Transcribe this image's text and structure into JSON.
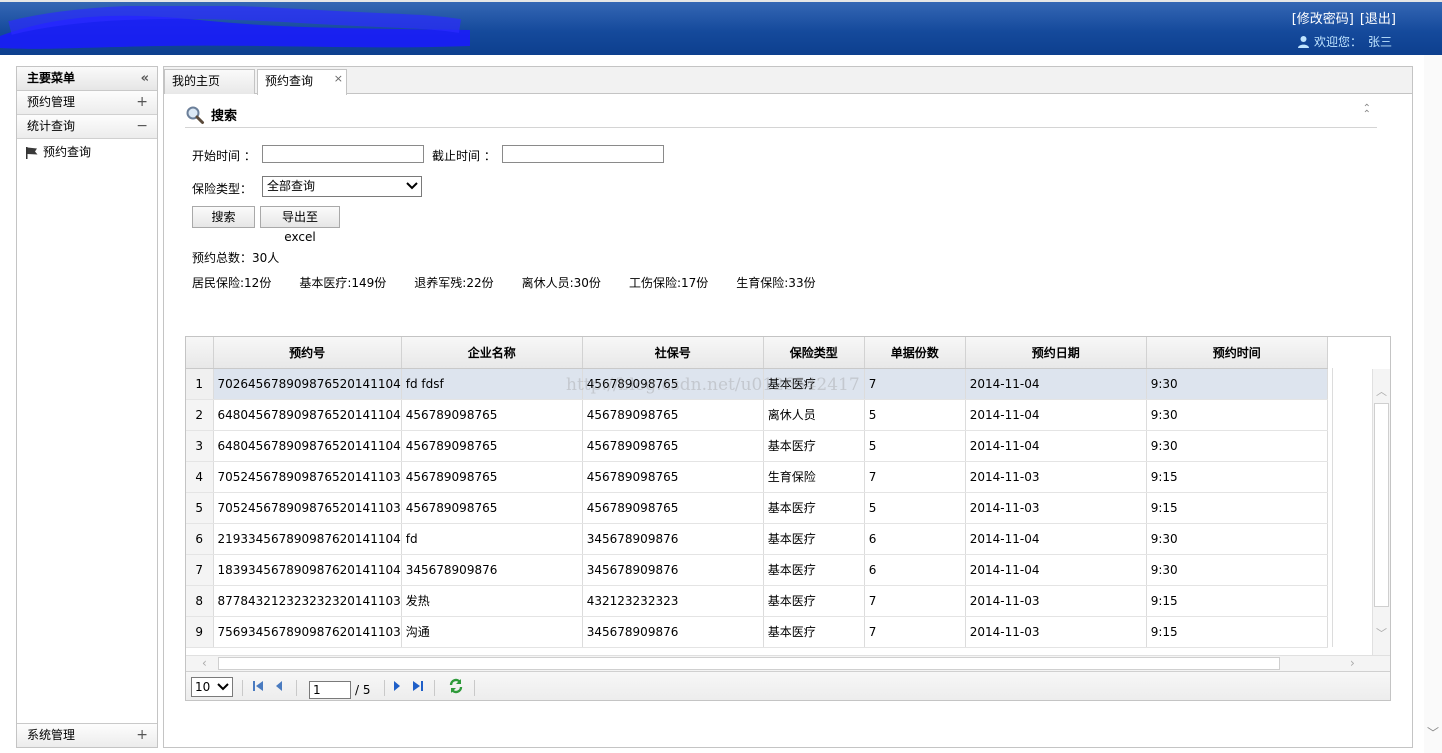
{
  "header": {
    "change_password": "[修改密码]",
    "logout": "[退出]",
    "welcome_label": "欢迎您：",
    "user_name": "张三"
  },
  "sidebar": {
    "title": "主要菜单",
    "collapse_glyph": "«",
    "groups": [
      {
        "label": "预约管理",
        "toggle": "+"
      },
      {
        "label": "统计查询",
        "toggle": "−"
      }
    ],
    "items": [
      {
        "label": "预约查询"
      }
    ],
    "bottom_group": {
      "label": "系统管理",
      "toggle": "+"
    }
  },
  "tabs": [
    {
      "label": "我的主页"
    },
    {
      "label": "预约查询",
      "close": "×"
    }
  ],
  "search": {
    "title": "搜索",
    "start_label": "开始时间 ：",
    "start_value": "",
    "end_label": "截止时间 ：",
    "end_value": "",
    "type_label": "保险类型：",
    "type_value": "全部查询",
    "search_button": "搜索",
    "export_button": "导出至excel"
  },
  "summary": {
    "total": "预约总数：30人",
    "items": [
      "居民保险:12份",
      "基本医疗:149份",
      "退养军残:22份",
      "离休人员:30份",
      "工伤保险:17份",
      "生育保险:33份"
    ]
  },
  "grid": {
    "columns": [
      "预约号",
      "企业名称",
      "社保号",
      "保险类型",
      "单据份数",
      "预约日期",
      "预约时间"
    ],
    "rows": [
      {
        "n": "1",
        "cells": [
          "70264567890987652014110​4",
          "fd fdsf",
          "456789098765",
          "基本医疗",
          "7",
          "2014-11-04",
          "9:30"
        ]
      },
      {
        "n": "2",
        "cells": [
          "64804567890987652014110​4",
          "456789098765",
          "456789098765",
          "离休人员",
          "5",
          "2014-11-04",
          "9:30"
        ]
      },
      {
        "n": "3",
        "cells": [
          "64804567890987652014110​4",
          "456789098765",
          "456789098765",
          "基本医疗",
          "5",
          "2014-11-04",
          "9:30"
        ]
      },
      {
        "n": "4",
        "cells": [
          "70524567890987652014110​3",
          "456789098765",
          "456789098765",
          "生育保险",
          "7",
          "2014-11-03",
          "9:15"
        ]
      },
      {
        "n": "5",
        "cells": [
          "70524567890987652014110​3",
          "456789098765",
          "456789098765",
          "基本医疗",
          "5",
          "2014-11-03",
          "9:15"
        ]
      },
      {
        "n": "6",
        "cells": [
          "21933456789098762014110​4",
          "fd",
          "345678909876",
          "基本医疗",
          "6",
          "2014-11-04",
          "9:30"
        ]
      },
      {
        "n": "7",
        "cells": [
          "18393456789098762014110​4",
          "345678909876",
          "345678909876",
          "基本医疗",
          "6",
          "2014-11-04",
          "9:30"
        ]
      },
      {
        "n": "8",
        "cells": [
          "87784321232323232014110​3",
          "发热",
          "432123232323",
          "基本医疗",
          "7",
          "2014-11-03",
          "9:15"
        ]
      },
      {
        "n": "9",
        "cells": [
          "75693456789098762014110​3",
          "沟通",
          "345678909876",
          "基本医疗",
          "7",
          "2014-11-03",
          "9:15"
        ]
      }
    ]
  },
  "pager": {
    "page_size": "10",
    "current_page": "1",
    "total_pages": "/ 5"
  },
  "watermark": "http://blog.csdn.net/u012654​2417",
  "colors": {
    "header_bg": "#154a9c",
    "welcome_text": "#bfe4ff",
    "selected_row": "#dde4ee"
  }
}
